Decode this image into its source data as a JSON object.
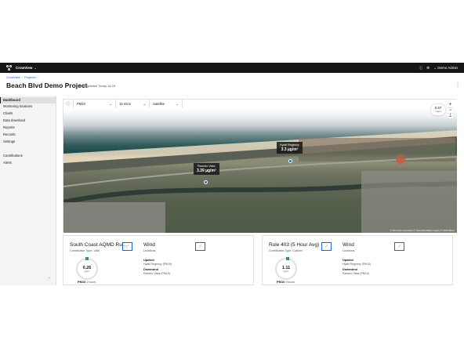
{
  "app": {
    "name": "CrowView",
    "user": "Demo Admin"
  },
  "breadcrumb": [
    "CrowView",
    "Projects"
  ],
  "page": {
    "title": "Beach Blvd Demo Project",
    "updated": "Last updated Today 14:28"
  },
  "sidebar": {
    "items": [
      {
        "label": "Dashboard",
        "active": true
      },
      {
        "label": "Monitoring locations"
      },
      {
        "label": "Charts"
      },
      {
        "label": "Data download"
      },
      {
        "label": "Reports"
      },
      {
        "label": "Records"
      },
      {
        "label": "Settings"
      },
      {
        "label": "Contributions"
      },
      {
        "label": "Alerts"
      }
    ]
  },
  "controls": {
    "pollutant": "PM10",
    "interval": "15 mins",
    "layer": "Satellite"
  },
  "map": {
    "aqi_value": "0.67",
    "aqi_unit": "mg/m",
    "markers": [
      {
        "name": "Hyatt Regency",
        "value": "3.3 µg/m³"
      },
      {
        "name": "Rancho Vista",
        "value": "3.39 µg/m³"
      }
    ],
    "attribution": "© Microsoft Corporation © OpenStreetMap Imagery © 2024 Maxar"
  },
  "cards": [
    {
      "title": "South Coast AQMD Ru...",
      "subtitle": "Contribution Type: 1466",
      "gauge_value": "0.26",
      "gauge_unit": "µg/m³",
      "pollutant": "PM10",
      "pollutant_note": "2 hours",
      "wind_title": "Wind",
      "wind_sub": "Locations",
      "upwind_label": "Upwind",
      "upwind_value": "Hyatt Regency (PM10)",
      "downwind_label": "Downwind",
      "downwind_value": "Rancho Vista (PM10)"
    },
    {
      "title": "Rule 403 (5 Hour Avg)",
      "subtitle": "Contribution Type: Custom",
      "gauge_value": "1.11",
      "gauge_unit": "µg/m³",
      "pollutant": "PM10",
      "pollutant_note": "5 hours",
      "wind_title": "Wind",
      "wind_sub": "Locations",
      "upwind_label": "Upwind",
      "upwind_value": "Hyatt Regency (PM10)",
      "downwind_label": "Downwind",
      "downwind_value": "Rancho Vista (PM10)"
    }
  ],
  "colors": {
    "accent": "#0f62fe",
    "topbar": "#161616",
    "status_good": "#24a148"
  }
}
